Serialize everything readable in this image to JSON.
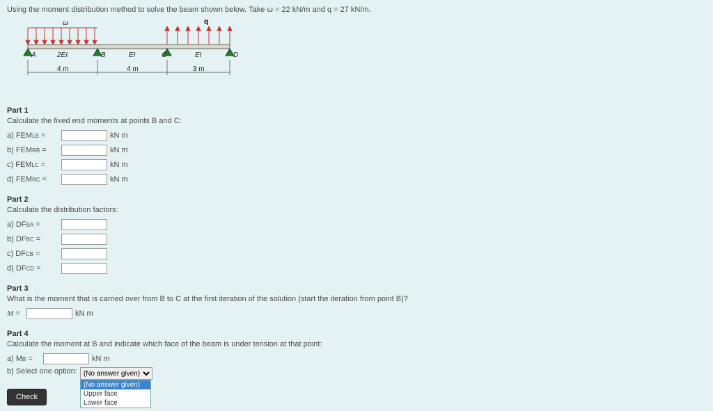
{
  "intro": "Using the moment distribution method to solve the beam shown below. Take ω = 22 kN/m and q = 27 kN/m.",
  "diagram": {
    "omega": "ω",
    "q": "q",
    "A": "A",
    "B": "B",
    "C": "C",
    "D": "D",
    "seg1": "2EI",
    "seg2": "EI",
    "seg3": "EI",
    "len1": "4 m",
    "len2": "4 m",
    "len3": "3 m"
  },
  "part1": {
    "title": "Part 1",
    "desc": "Calculate the fixed end moments at points B and C:",
    "a": "a) FEM",
    "a_sup": "L",
    "a_sub": "B",
    "b": "b) FEM",
    "b_sup": "R",
    "b_sub": "B",
    "c": "c) FEM",
    "c_sup": "L",
    "c_sub": "C",
    "d": "d) FEM",
    "d_sup": "R",
    "d_sub": "C",
    "unit": "kN m"
  },
  "part2": {
    "title": "Part 2",
    "desc": "Calculate the distribution factors:",
    "a": "a) DF",
    "a_sub": "BA",
    "b": "b) DF",
    "b_sub": "BC",
    "c": "c) DF",
    "c_sub": "CB",
    "d": "d) DF",
    "d_sub": "CD"
  },
  "part3": {
    "title": "Part 3",
    "desc": "What is the moment that is carried over from B to C at the first iteration of the solution (start the iteration from point B)?",
    "M": "M",
    "unit": "kN m"
  },
  "part4": {
    "title": "Part 4",
    "desc": "Calculate the moment at B and indicate which face of the beam is under tension at that point:",
    "a": "a) M",
    "a_sub": "B",
    "unit": "kN m",
    "b": "b) Select one option:",
    "sel_current": "(No answer given)",
    "opts": [
      "(No answer given)",
      "Upper face",
      "Lower face"
    ]
  },
  "check": "Check"
}
